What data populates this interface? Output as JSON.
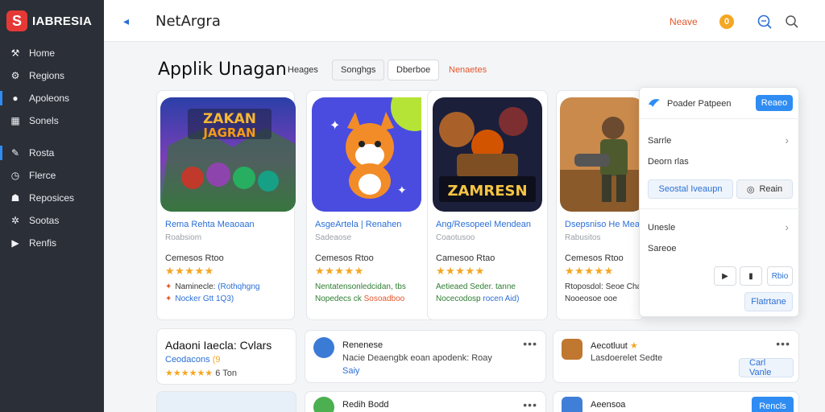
{
  "sidebar": {
    "logo_mark": "S",
    "logo_text": "IABRESIA",
    "items": [
      {
        "label": "Home",
        "icon": "home-icon",
        "glyph": "⚒"
      },
      {
        "label": "Regions",
        "icon": "settings-icon",
        "glyph": "⚙"
      },
      {
        "label": "Apoleons",
        "icon": "circle-dot-icon",
        "glyph": "●",
        "active": true
      },
      {
        "label": "Sonels",
        "icon": "grid-icon",
        "glyph": "▦"
      },
      {
        "label": "Rosta",
        "icon": "pen-icon",
        "glyph": "✎",
        "active": true
      },
      {
        "label": "Flerce",
        "icon": "clock-icon",
        "glyph": "◷"
      },
      {
        "label": "Reposices",
        "icon": "people-icon",
        "glyph": "☗"
      },
      {
        "label": "Sootas",
        "icon": "gear-icon",
        "glyph": "✲"
      },
      {
        "label": "Renfis",
        "icon": "play-icon",
        "glyph": "▶"
      }
    ]
  },
  "topbar": {
    "back_glyph": "◂",
    "title": "NetArgra",
    "link": "Neave",
    "coin": "0"
  },
  "page": {
    "title": "Applik Unagan",
    "filters": [
      "Heages",
      "Songhgs",
      "Dberboe",
      "Nenaetes"
    ]
  },
  "cards": [
    {
      "title": "Rema Rehta Meaoaan",
      "sub": "Roabsiom",
      "meta": "Cemesos Rtoo",
      "stars": "★★★★★",
      "note1_a": "Naminecle:",
      "note1_b": "(Rothqhgng",
      "note2_a": "Nocker",
      "note2_b": "Gtt 1Q3)",
      "badge": "ZAKAN JAGRAN"
    },
    {
      "title": "AsgeArtela | Renahen",
      "sub": "Sadeaose",
      "meta": "Cemesos Rtoo",
      "stars": "★★★★★",
      "note1_a": "Nentatensonledcidan, tbs",
      "note1_b": "",
      "note2_a": "Nopedecs ck",
      "note2_b": "Sosoadboo",
      "badge": ""
    },
    {
      "title": "Ang/Resopeel Mendean",
      "sub": "Coaotusoo",
      "meta": "Camesoo Rtao",
      "stars": "★★★★★",
      "note1_a": "Aetieaed Seder. tanne",
      "note1_b": "",
      "note2_a": "Nocecodosp",
      "note2_b": "rocen Aid)",
      "badge": "ZAMRESN"
    },
    {
      "title": "Dsepsniso He Meanth",
      "sub": "Rabusitos",
      "meta": "Cemesos Rtoo",
      "stars": "★★★★★",
      "note1_a": "Rtoposdol: Seoe Cha",
      "note1_b": "",
      "note2_a": "Nooeosoe ooe",
      "note2_b": "",
      "badge": ""
    }
  ],
  "bottom": {
    "left_title": "Adaoni Iaecla: Cvlars",
    "left_sub": "Ceodacons",
    "left_sub_hl": "(9",
    "left_stars": "★★★★★★",
    "left_meta": "6 Ton",
    "mid_name": "Renenese",
    "mid_desc": "Nacie Deaengbk eoan apodenk: Roay",
    "mid_desc2": "Saiy",
    "mid2_name": "Redih Bodd",
    "right_name": "Aecotluut",
    "right_desc": "Lasdoerelet Sedte",
    "right_btn": "Carl Vanle",
    "right2_name": "Aeensoa",
    "right2_btn": "Rencls",
    "more_glyph": "•••"
  },
  "panel": {
    "header": "Poader Patpeen",
    "header_btn": "Reaeo",
    "row1": "Sarrle",
    "row2": "Deorn rlas",
    "btn_left": "Seostal Iveaupn",
    "btn_right": "Reain",
    "row3": "Unesle",
    "row4": "Sareoe",
    "small1": "▶",
    "small2": "▮",
    "small3": "Rbio",
    "bottom_btn": "Flatrtane"
  },
  "colors": {
    "sidebar_bg": "#2b2f37",
    "accent_blue": "#2f8cf3",
    "accent_orange": "#e4572e",
    "star": "#f5a623"
  }
}
